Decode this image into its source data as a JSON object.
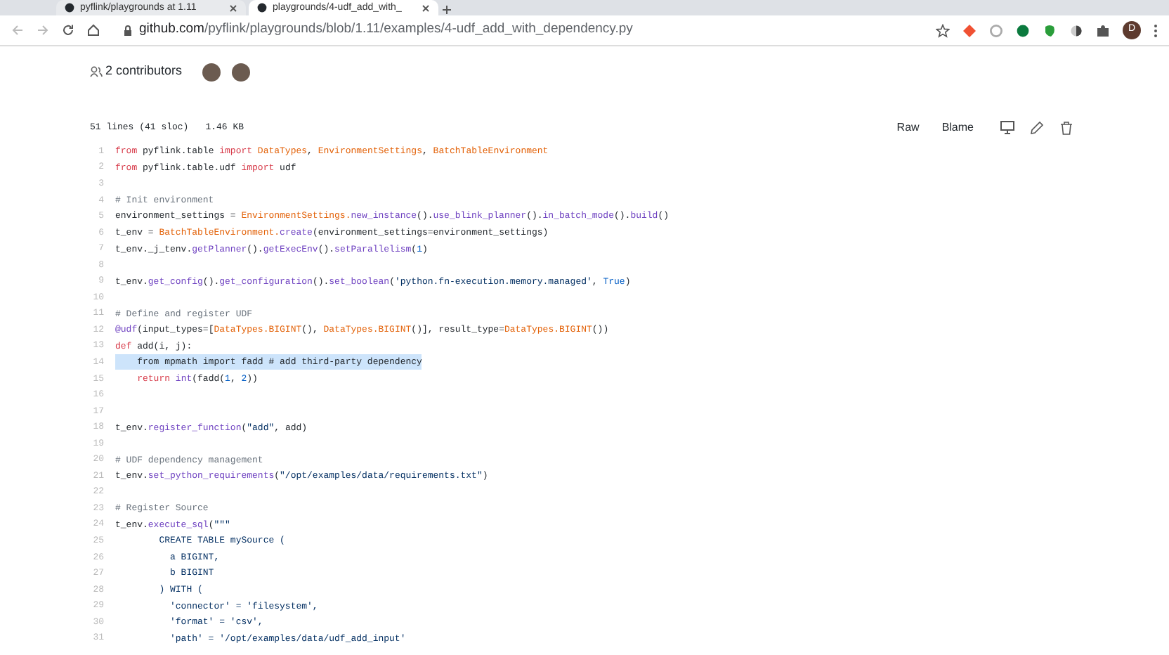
{
  "browser": {
    "tabs": [
      {
        "title": "pyflink/playgrounds at 1.11",
        "selected": false
      },
      {
        "title": "playgrounds/4-udf_add_with_",
        "selected": true
      }
    ],
    "url_host": "github.com",
    "url_path": "/pyflink/playgrounds/blob/1.11/examples/4-udf_add_with_dependency.py",
    "profile_letter": "D"
  },
  "file_header": {
    "contributors": "2 contributors",
    "info": [
      "51 lines (41 sloc)",
      "1.46 KB"
    ],
    "actions": [
      "Raw",
      "Blame"
    ]
  },
  "code": {
    "lines": [
      {
        "number": "1",
        "highlighted": false,
        "tokens": [
          {
            "kind": "kw",
            "text": "from"
          },
          {
            "kind": "pl",
            "text": " pyflink.table "
          },
          {
            "kind": "kw",
            "text": "import"
          },
          {
            "kind": "cls",
            "text": " DataTypes"
          },
          {
            "kind": "pl",
            "text": ", "
          },
          {
            "kind": "cls",
            "text": "EnvironmentSettings"
          },
          {
            "kind": "pl",
            "text": ", "
          },
          {
            "kind": "cls",
            "text": "BatchTableEnvironment"
          }
        ]
      },
      {
        "number": "2",
        "highlighted": false,
        "tokens": [
          {
            "kind": "kw",
            "text": "from"
          },
          {
            "kind": "pl",
            "text": " pyflink.table.udf "
          },
          {
            "kind": "kw",
            "text": "import"
          },
          {
            "kind": "pl",
            "text": " udf"
          }
        ]
      },
      {
        "number": "3",
        "highlighted": false
      },
      {
        "number": "4",
        "highlighted": false,
        "tokens": [
          {
            "kind": "cm",
            "text": "# Init environment"
          }
        ]
      },
      {
        "number": "5",
        "highlighted": false,
        "tokens": [
          {
            "kind": "pl",
            "text": "environment_settings = "
          },
          {
            "kind": "cls",
            "text": "EnvironmentSettings."
          },
          {
            "kind": "fn",
            "text": "new_instance"
          },
          {
            "kind": "pl",
            "text": "()."
          },
          {
            "kind": "fn",
            "text": "use_blink_planner"
          },
          {
            "kind": "pl",
            "text": "()."
          },
          {
            "kind": "fn",
            "text": "in_batch_mode"
          },
          {
            "kind": "pl",
            "text": "()."
          },
          {
            "kind": "fn",
            "text": "build"
          },
          {
            "kind": "pl",
            "text": "()"
          }
        ]
      },
      {
        "number": "6",
        "highlighted": false,
        "tokens": [
          {
            "kind": "pl",
            "text": "t_env = "
          },
          {
            "kind": "cls",
            "text": "BatchTableEnvironment."
          },
          {
            "kind": "fn",
            "text": "create"
          },
          {
            "kind": "pl",
            "text": "(environment_settings=environment_settings)"
          }
        ]
      },
      {
        "number": "7",
        "highlighted": false,
        "tokens": [
          {
            "kind": "pl",
            "text": "t_env._j_tenv."
          },
          {
            "kind": "fn",
            "text": "getPlanner"
          },
          {
            "kind": "pl",
            "text": "()."
          },
          {
            "kind": "fn",
            "text": "getExecEnv"
          },
          {
            "kind": "pl",
            "text": "()."
          },
          {
            "kind": "fn",
            "text": "setParallelism"
          },
          {
            "kind": "pl",
            "text": "("
          },
          {
            "kind": "num",
            "text": "1"
          },
          {
            "kind": "pl",
            "text": ")"
          }
        ]
      },
      {
        "number": "8",
        "highlighted": false
      },
      {
        "number": "9",
        "highlighted": false,
        "tokens": [
          {
            "kind": "pl",
            "text": "t_env."
          },
          {
            "kind": "fn",
            "text": "get_config"
          },
          {
            "kind": "pl",
            "text": "()."
          },
          {
            "kind": "fn",
            "text": "get_configuration"
          },
          {
            "kind": "pl",
            "text": "()."
          },
          {
            "kind": "fn",
            "text": "set_boolean"
          },
          {
            "kind": "pl",
            "text": "("
          },
          {
            "kind": "str",
            "text": "'python.fn-execution.memory.managed'"
          },
          {
            "kind": "pl",
            "text": ", "
          },
          {
            "kind": "num",
            "text": "True"
          },
          {
            "kind": "pl",
            "text": ")"
          }
        ]
      },
      {
        "number": "10",
        "highlighted": false
      },
      {
        "number": "11",
        "highlighted": false,
        "tokens": [
          {
            "kind": "cm",
            "text": "# Define and register UDF"
          }
        ]
      },
      {
        "number": "12",
        "highlighted": false,
        "tokens": [
          {
            "kind": "fn",
            "text": "@udf"
          },
          {
            "kind": "pl",
            "text": "(input_types=["
          },
          {
            "kind": "cls",
            "text": "DataTypes.BIGINT"
          },
          {
            "kind": "pl",
            "text": "(), "
          },
          {
            "kind": "cls",
            "text": "DataTypes.BIGINT"
          },
          {
            "kind": "pl",
            "text": "()], result_type="
          },
          {
            "kind": "cls",
            "text": "DataTypes.BIGINT"
          },
          {
            "kind": "pl",
            "text": "())"
          }
        ]
      },
      {
        "number": "13",
        "highlighted": false,
        "tokens": [
          {
            "kind": "kw",
            "text": "def"
          },
          {
            "kind": "pl",
            "text": " add(i, j):"
          }
        ]
      },
      {
        "number": "14",
        "highlighted": true,
        "tokens": [
          {
            "kind": "pl",
            "text": "    from mpmath import fadd # add third-party dependency"
          }
        ]
      },
      {
        "number": "15",
        "highlighted": false,
        "tokens": [
          {
            "kind": "kw",
            "text": "    return"
          },
          {
            "kind": "fn",
            "text": " int"
          },
          {
            "kind": "pl",
            "text": "(fadd("
          },
          {
            "kind": "num",
            "text": "1"
          },
          {
            "kind": "pl",
            "text": ", "
          },
          {
            "kind": "num",
            "text": "2"
          },
          {
            "kind": "pl",
            "text": "))"
          }
        ]
      },
      {
        "number": "16",
        "highlighted": false
      },
      {
        "number": "17",
        "highlighted": false
      },
      {
        "number": "18",
        "highlighted": false,
        "tokens": [
          {
            "kind": "pl",
            "text": "t_env."
          },
          {
            "kind": "fn",
            "text": "register_function"
          },
          {
            "kind": "pl",
            "text": "("
          },
          {
            "kind": "str",
            "text": "\"add\""
          },
          {
            "kind": "pl",
            "text": ", add)"
          }
        ]
      },
      {
        "number": "19",
        "highlighted": false
      },
      {
        "number": "20",
        "highlighted": false,
        "tokens": [
          {
            "kind": "cm",
            "text": "# UDF dependency management"
          }
        ]
      },
      {
        "number": "21",
        "highlighted": false,
        "tokens": [
          {
            "kind": "pl",
            "text": "t_env."
          },
          {
            "kind": "fn",
            "text": "set_python_requirements"
          },
          {
            "kind": "pl",
            "text": "("
          },
          {
            "kind": "str",
            "text": "\"/opt/examples/data/requirements.txt\""
          },
          {
            "kind": "pl",
            "text": ")"
          }
        ]
      },
      {
        "number": "22",
        "highlighted": false
      },
      {
        "number": "23",
        "highlighted": false,
        "tokens": [
          {
            "kind": "cm",
            "text": "# Register Source"
          }
        ]
      },
      {
        "number": "24",
        "highlighted": false,
        "tokens": [
          {
            "kind": "pl",
            "text": "t_env."
          },
          {
            "kind": "fn",
            "text": "execute_sql"
          },
          {
            "kind": "pl",
            "text": "("
          },
          {
            "kind": "str",
            "text": "\"\"\""
          }
        ]
      },
      {
        "number": "25",
        "highlighted": false,
        "tokens": [
          {
            "kind": "str",
            "text": "        CREATE TABLE mySource ("
          }
        ]
      },
      {
        "number": "26",
        "highlighted": false,
        "tokens": [
          {
            "kind": "str",
            "text": "          a BIGINT,"
          }
        ]
      },
      {
        "number": "27",
        "highlighted": false,
        "tokens": [
          {
            "kind": "str",
            "text": "          b BIGINT"
          }
        ]
      },
      {
        "number": "28",
        "highlighted": false,
        "tokens": [
          {
            "kind": "str",
            "text": "        ) WITH ("
          }
        ]
      },
      {
        "number": "29",
        "highlighted": false,
        "tokens": [
          {
            "kind": "str",
            "text": "          'connector' = 'filesystem',"
          }
        ]
      },
      {
        "number": "30",
        "highlighted": false,
        "tokens": [
          {
            "kind": "str",
            "text": "          'format' = 'csv',"
          }
        ]
      },
      {
        "number": "31",
        "highlighted": false,
        "tokens": [
          {
            "kind": "str",
            "text": "          'path' = '/opt/examples/data/udf_add_input'"
          }
        ]
      }
    ]
  }
}
